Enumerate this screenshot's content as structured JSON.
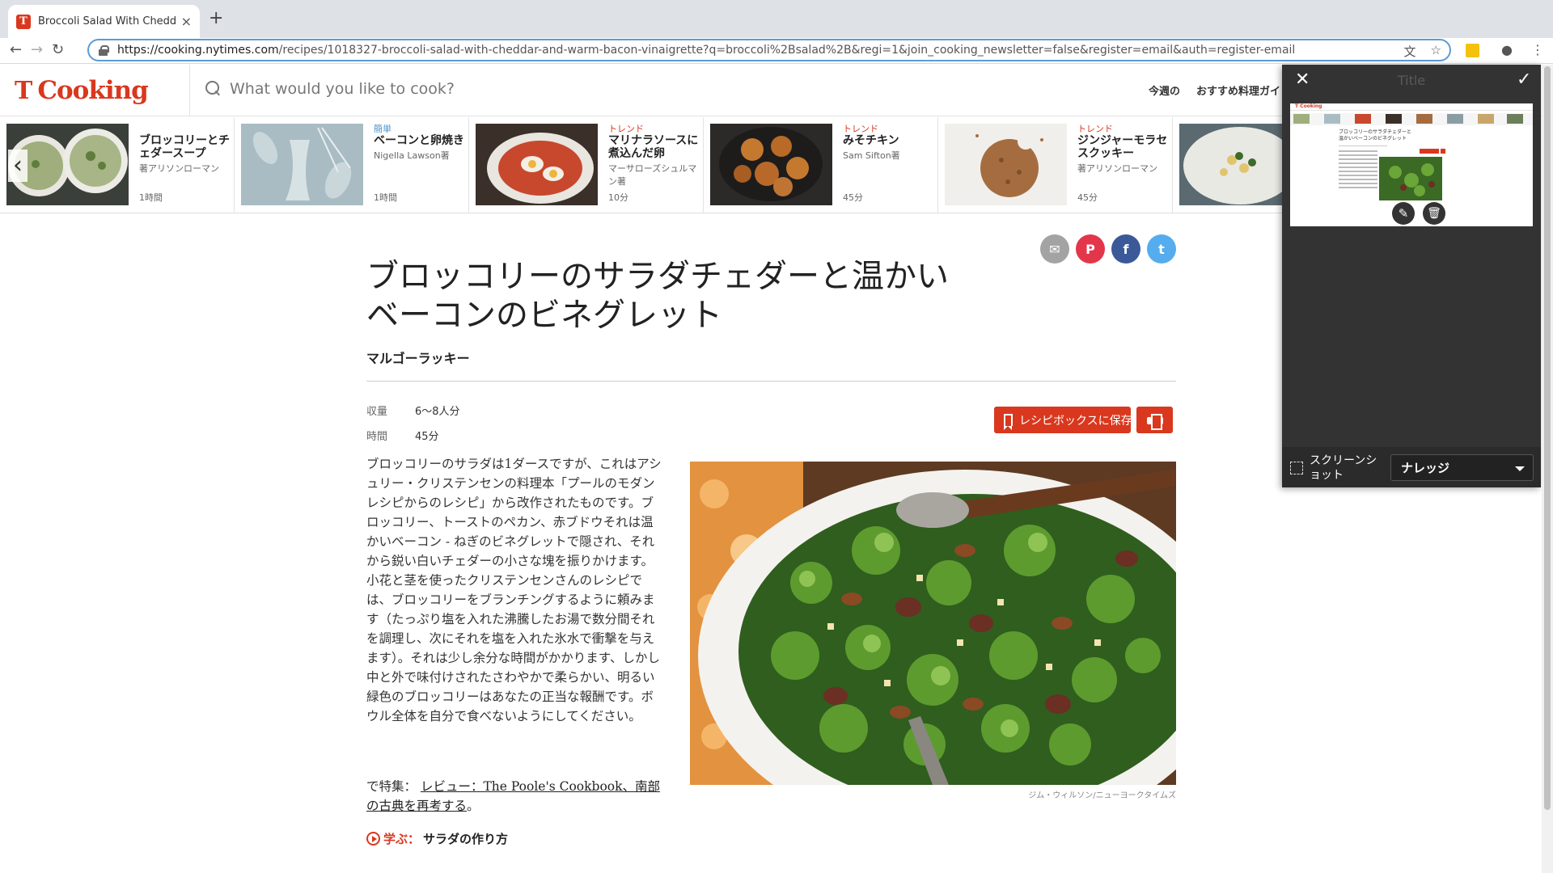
{
  "browser": {
    "tab_title": "Broccoli Salad With Cheddar and Warm Bacon Vinaigrette",
    "tab_favicon": "T",
    "tab_close": "×",
    "new_tab": "+",
    "url_domain": "https://cooking.nytimes.com",
    "url_path": "/recipes/1018327-broccoli-salad-with-cheddar-and-warm-bacon-vinaigrette?q=broccoli%2Bsalad%2B&regi=1&join_cooking_newsletter=false&register=email&auth=register-email",
    "icons": [
      "back-icon",
      "forward-icon",
      "reload-icon",
      "lock-icon",
      "translate-icon",
      "star-icon",
      "extension-icon",
      "account-icon",
      "menu-icon"
    ]
  },
  "header": {
    "logo_t": "T",
    "logo_word": "Cooking",
    "search_placeholder": "What would you like to cook?",
    "nav": [
      "今週の",
      "おすすめ料理ガイド"
    ]
  },
  "carousel": [
    {
      "tag": "",
      "title": "ブロッコリーとチェダースープ",
      "author": "著アリソンローマン",
      "time": "1時間"
    },
    {
      "tag": "簡単",
      "title": "ベーコンと卵焼き",
      "author": "Nigella Lawson著",
      "time": "1時間"
    },
    {
      "tag": "トレンド",
      "title": "マリナラソースに煮込んだ卵",
      "author": "マーサローズシュルマン著",
      "time": "10分"
    },
    {
      "tag": "トレンド",
      "title": "みそチキン",
      "author": "Sam Sifton著",
      "time": "45分"
    },
    {
      "tag": "トレンド",
      "title": "ジンジャーモラセスクッキー",
      "author": "著アリソンローマン",
      "time": "45分"
    },
    {
      "tag": "",
      "title": "",
      "author": "",
      "time": ""
    }
  ],
  "carousel_prev": "‹",
  "share": {
    "email": "✉",
    "pinterest": "P",
    "facebook": "f",
    "twitter": "t"
  },
  "recipe": {
    "title": "ブロッコリーのサラダチェダーと温かいベーコンのビネグレット",
    "byline": "マルゴーラッキー",
    "yield_label": "収量",
    "yield_value": "6〜8人分",
    "time_label": "時間",
    "time_value": "45分",
    "save_label": "レシピボックスに保存",
    "description": "ブロッコリーのサラダは1ダースですが、これはアシュリー・クリステンセンの料理本「プールのモダンレシピからのレシピ」から改作されたものです。ブロッコリー、トーストのペカン、赤ブドウそれは温かいベーコン - ねぎのビネグレットで隠され、それから鋭い白いチェダーの小さな塊を振りかけます。小花と茎を使ったクリステンセンさんのレシピでは、ブロッコリーをブランチングするように頼みます（たっぷり塩を入れた沸騰したお湯で数分間それを調理し、次にそれを塩を入れた氷水で衝撃を与えます）。それは少し余分な時間がかかります、しかし中と外で味付けされたさわやかで柔らかい、明るい緑色のブロッコリーはあなたの正当な報酬です。ボウル全体を自分で食べないようにしてください。",
    "featured_prefix": "で特集：",
    "featured_link": "レビュー：The Poole's Cookbook、南部の古典を再考する",
    "featured_suffix": "。",
    "learn_label": "学ぶ：",
    "learn_text": "サラダの作り方",
    "photo_credit": "ジム・ウィルソン/ニューヨークタイムズ"
  },
  "panel": {
    "close": "✕",
    "title": "Title",
    "confirm": "✓",
    "thumb_title": "ブロッコリーのサラダチェダーと温かいベーコンのビネグレット",
    "thumb_logo": "T Cooking",
    "edit_icon": "✎",
    "trash_icon": "🗑",
    "screenshot_label": "スクリーンショット",
    "category_selected": "ナレッジ"
  },
  "colors": {
    "brand": "#d9381e",
    "email": "#a3a3a3",
    "pinterest": "#e3364b",
    "facebook": "#3b5998",
    "twitter": "#55acee"
  }
}
